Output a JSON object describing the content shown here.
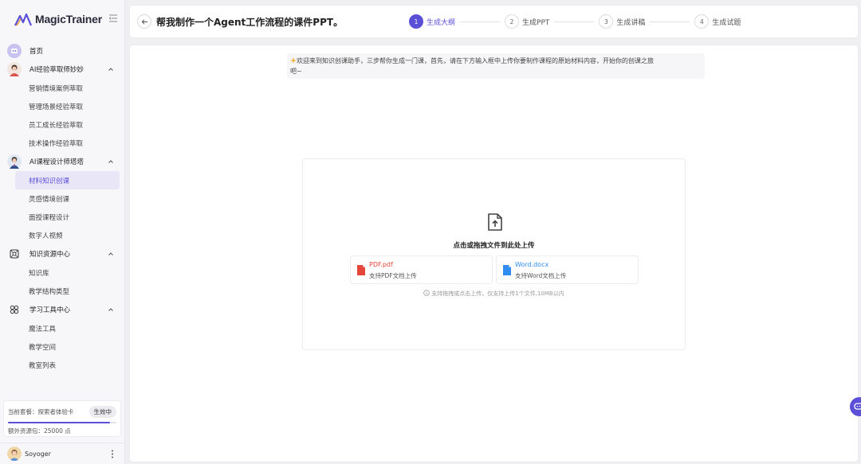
{
  "app": {
    "brand": "MagicTrainer"
  },
  "sidebar": {
    "home": "首页",
    "groups": [
      {
        "label": "AI经验萃取师妙妙",
        "items": [
          "营销情境案例萃取",
          "管理场景经验萃取",
          "员工成长经验萃取",
          "技术操作经验萃取"
        ]
      },
      {
        "label": "AI课程设计师塔塔",
        "items": [
          "材料知识创课",
          "灵感情境创课",
          "面授课程设计",
          "数字人视频"
        ],
        "active_item": "材料知识创课"
      },
      {
        "label": "知识资源中心",
        "items": [
          "知识库",
          "教学结构类型"
        ]
      },
      {
        "label": "学习工具中心",
        "items": [
          "魔法工具",
          "教学空间",
          "教室列表"
        ]
      }
    ],
    "plan": {
      "label": "当前套餐：探索者体验卡",
      "status": "生效中",
      "progress": 0.94,
      "extra": "额外资源包：25000 点"
    },
    "user": {
      "name": "Soyoger"
    }
  },
  "header": {
    "title": "帮我制作一个Agent工作流程的课件PPT。",
    "steps": [
      {
        "num": "1",
        "label": "生成大纲",
        "active": true
      },
      {
        "num": "2",
        "label": "生成PPT",
        "active": false
      },
      {
        "num": "3",
        "label": "生成讲稿",
        "active": false
      },
      {
        "num": "4",
        "label": "生成试题",
        "active": false
      }
    ]
  },
  "main": {
    "welcome_line1": "欢迎来到知识创课助手，三步帮你生成一门课，首先，请在下方输入框中上传你要制作课程的原始材料内容，开始你的创课之旅",
    "welcome_line2": "吧~",
    "upload": {
      "title": "点击或拖拽文件到此处上传",
      "pdf_name": "PDF.pdf",
      "pdf_desc": "支持PDF文档上传",
      "word_name": "Word.docx",
      "word_desc": "支持Word文档上传",
      "note": "支持拖拽或点击上传，仅支持上传1个文件,10MB以内"
    }
  },
  "colors": {
    "accent": "#5b4fd8",
    "pdf": "#e5463b",
    "word": "#2f8cf0"
  }
}
